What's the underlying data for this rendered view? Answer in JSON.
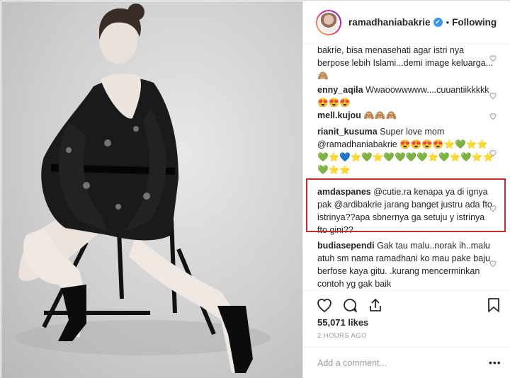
{
  "post": {
    "username": "ramadhaniabakrie",
    "verified_badge": "✔",
    "separator": "•",
    "follow_status": "Following",
    "likes": "55,071 likes",
    "date": "2 HOURS AGO",
    "add_comment_placeholder": "Add a comment...",
    "more_icon": "•••"
  },
  "comments": [
    {
      "user": "",
      "text": "bakrie, bisa menasehati agar istri nya berpose lebih Islami...demi image keluarga...🙈"
    },
    {
      "user": "enny_aqila",
      "text": "Wwaoowwwww....cuuantiikkkkk😍😍😍"
    },
    {
      "user": "mell.kujou",
      "text": "🙈🙈🙈"
    },
    {
      "user": "rianit_kusuma",
      "text": "Super love mom @ramadhaniabakrie 😍😍😍😍⭐💚⭐⭐💚⭐💙⭐💚⭐💚💚💚💚⭐💚⭐💚⭐⭐💚⭐⭐"
    },
    {
      "user": "amdaspanes",
      "text": "@cutie.ra kenapa ya di ignya pak @ardibakrie jarang banget justru ada fto istrinya??apa sbnernya ga setuju y istrinya fto gini??"
    },
    {
      "user": "budiasependi",
      "text": "Gak tau malu..norak ih..malu atuh sm nama ramadhani ko mau pake baju berfose kaya gitu. .kurang mencerminkan contoh yg gak baik"
    }
  ],
  "colors": {
    "verified": "#3897f0",
    "highlight_box": "#c62d2d",
    "muted_text": "#999999",
    "text": "#262626"
  },
  "icons": [
    "heart-icon",
    "comment-icon",
    "share-icon",
    "bookmark-icon",
    "more-options-icon",
    "verified-badge-icon"
  ]
}
